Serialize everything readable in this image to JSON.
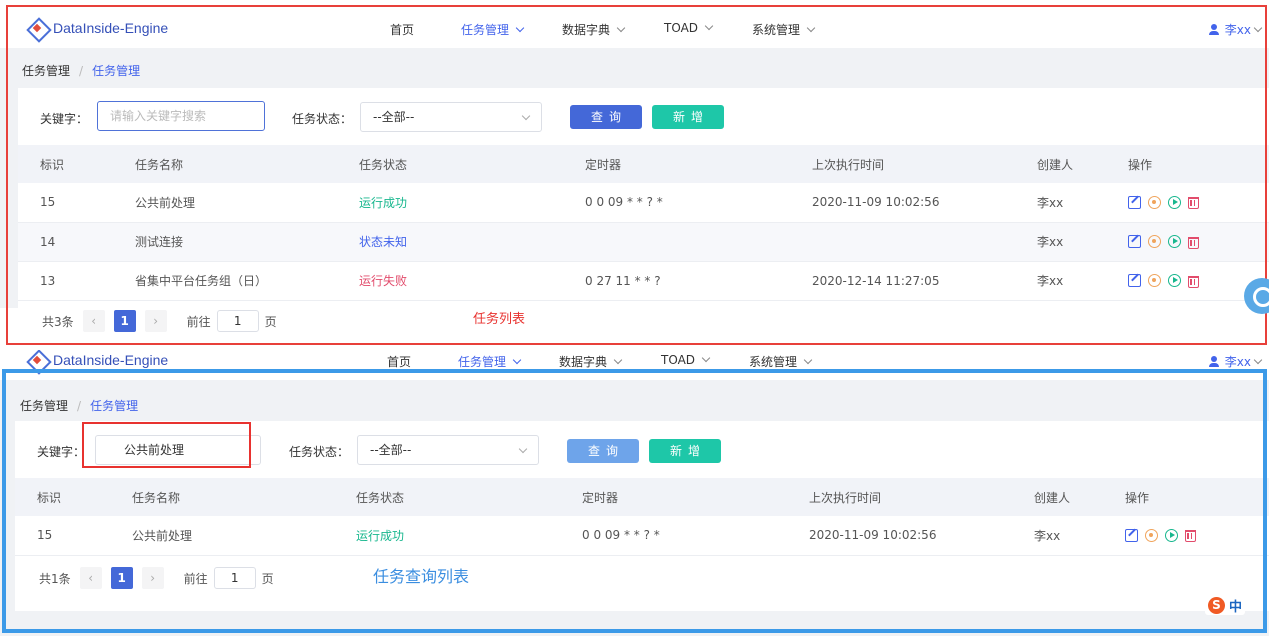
{
  "app": {
    "logo_text": "DataInside-Engine"
  },
  "nav": {
    "home": "首页",
    "task_mgmt": "任务管理",
    "data_dict": "数据字典",
    "toad": "TOAD",
    "sys_mgmt": "系统管理",
    "user": "李xx"
  },
  "breadcrumb": {
    "root": "任务管理",
    "sep": "/",
    "current": "任务管理"
  },
  "search": {
    "keyword_label": "关键字：",
    "keyword_placeholder": "请输入关键字搜索",
    "status_label": "任务状态：",
    "status_value": "--全部--",
    "query_btn": "查询",
    "add_btn": "新增"
  },
  "table": {
    "headers": [
      "标识",
      "任务名称",
      "任务状态",
      "定时器",
      "上次执行时间",
      "创建人",
      "操作"
    ]
  },
  "panel1": {
    "rows": [
      {
        "id": "15",
        "name": "公共前处理",
        "status": "运行成功",
        "timer": "0 0 09 * * ? *",
        "last_run": "2020-11-09 10:02:56",
        "creator": "李xx"
      },
      {
        "id": "14",
        "name": "测试连接",
        "status": "状态未知",
        "timer": "",
        "last_run": "",
        "creator": "李xx"
      },
      {
        "id": "13",
        "name": "省集中平台任务组（日）",
        "status": "运行失败",
        "timer": "0 27 11 * * ?",
        "last_run": "2020-12-14 11:27:05",
        "creator": "李xx"
      }
    ],
    "total": "共3条",
    "page": "1",
    "goto_label": "前往",
    "goto_value": "1",
    "page_suffix": "页",
    "annotation": "任务列表"
  },
  "panel2": {
    "keyword_value": "公共前处理",
    "rows": [
      {
        "id": "15",
        "name": "公共前处理",
        "status": "运行成功",
        "timer": "0 0 09 * * ? *",
        "last_run": "2020-11-09 10:02:56",
        "creator": "李xx"
      }
    ],
    "total": "共1条",
    "page": "1",
    "goto_label": "前往",
    "goto_value": "1",
    "page_suffix": "页",
    "annotation": "任务查询列表"
  },
  "ime": {
    "mode": "中"
  },
  "colors": {
    "accent": "#4263eb",
    "success": "#18b78e",
    "fail": "#e24c6c",
    "red_frame": "#e8403a",
    "blue_frame": "#3c9ae8"
  }
}
